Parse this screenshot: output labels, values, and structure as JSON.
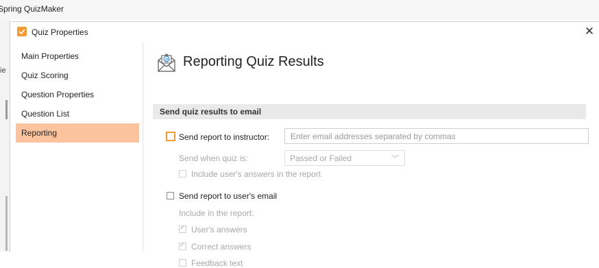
{
  "app": {
    "title": "Spring QuizMaker",
    "left_fragment_1": "ie"
  },
  "dialog": {
    "title": "Quiz Properties",
    "close_icon": "close-icon"
  },
  "nav": {
    "items": [
      {
        "label": "Main Properties"
      },
      {
        "label": "Quiz Scoring"
      },
      {
        "label": "Question Properties"
      },
      {
        "label": "Question List"
      },
      {
        "label": "Reporting",
        "active": true
      }
    ]
  },
  "page": {
    "title": "Reporting Quiz Results",
    "section": "Send quiz results to email",
    "instructor": {
      "label": "Send report to instructor:",
      "checked": false,
      "email_placeholder": "Enter email addresses separated by commas",
      "email_value": "",
      "send_when_label": "Send when quiz is:",
      "send_when_value": "Passed or Failed",
      "include_answers_label": "Include user's answers in the report"
    },
    "user": {
      "label": "Send report to user's email",
      "checked": false,
      "include_label": "Include in the report:",
      "options": [
        {
          "label": "User's answers",
          "checked": true
        },
        {
          "label": "Correct answers",
          "checked": true
        },
        {
          "label": "Feedback text",
          "checked": false
        }
      ]
    }
  },
  "colors": {
    "accent": "#f39b32",
    "nav_active": "#fcc49e",
    "section_band": "#e9e9e9"
  }
}
